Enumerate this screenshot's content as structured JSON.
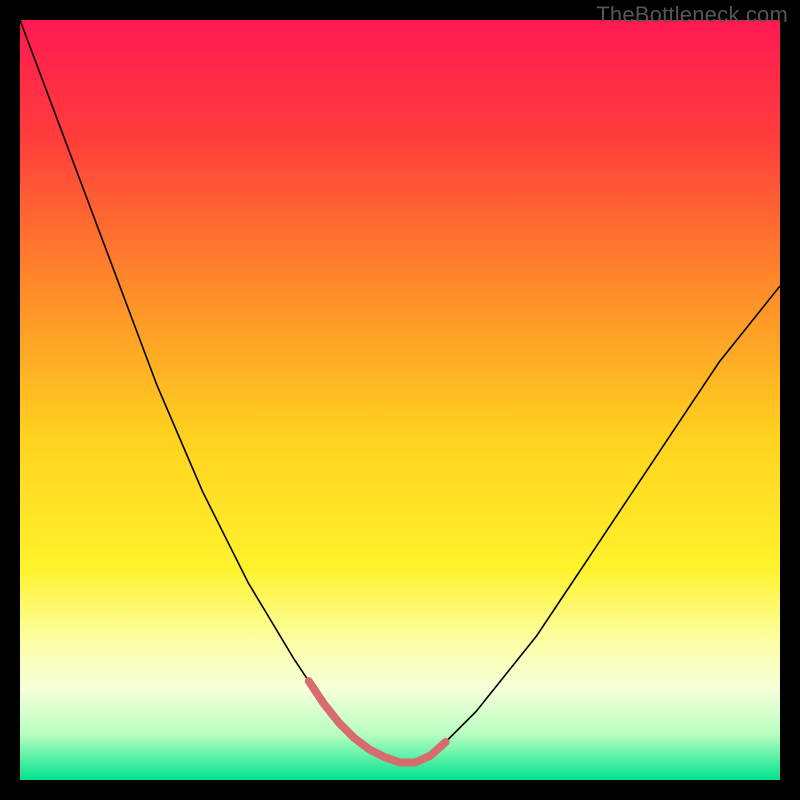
{
  "watermark": "TheBottleneck.com",
  "chart_data": {
    "type": "line",
    "title": "",
    "xlabel": "",
    "ylabel": "",
    "xlim": [
      0,
      100
    ],
    "ylim": [
      0,
      100
    ],
    "background": {
      "type": "vertical-gradient",
      "stops": [
        {
          "pos": 0.0,
          "color": "#ff1a52"
        },
        {
          "pos": 0.15,
          "color": "#ff3b3b"
        },
        {
          "pos": 0.35,
          "color": "#ff8a2a"
        },
        {
          "pos": 0.55,
          "color": "#ffd21f"
        },
        {
          "pos": 0.72,
          "color": "#fff22b"
        },
        {
          "pos": 0.82,
          "color": "#fbffa8"
        },
        {
          "pos": 0.88,
          "color": "#f6ffd8"
        },
        {
          "pos": 0.94,
          "color": "#b7ffc0"
        },
        {
          "pos": 1.0,
          "color": "#00e38e"
        }
      ]
    },
    "series": [
      {
        "name": "curve",
        "stroke": "#000000",
        "stroke_width": 1.6,
        "x": [
          0,
          3,
          6,
          9,
          12,
          15,
          18,
          21,
          24,
          27,
          30,
          33,
          36,
          38,
          40,
          42,
          44,
          46,
          48,
          50,
          52,
          54,
          56,
          60,
          64,
          68,
          72,
          76,
          80,
          84,
          88,
          92,
          96,
          100
        ],
        "y": [
          100,
          92,
          84,
          76,
          68,
          60,
          52,
          45,
          38,
          32,
          26,
          21,
          16,
          13,
          10,
          7.5,
          5.5,
          4,
          3,
          2.3,
          2.3,
          3.2,
          5,
          9,
          14,
          19,
          25,
          31,
          37,
          43,
          49,
          55,
          60,
          65
        ]
      },
      {
        "name": "highlight",
        "stroke": "#d86b6f",
        "stroke_width": 8,
        "linecap": "round",
        "x": [
          38,
          40,
          42,
          44,
          46,
          48,
          50,
          52,
          54,
          56
        ],
        "y": [
          13,
          10,
          7.5,
          5.5,
          4,
          3,
          2.3,
          2.3,
          3.2,
          5
        ]
      }
    ]
  }
}
